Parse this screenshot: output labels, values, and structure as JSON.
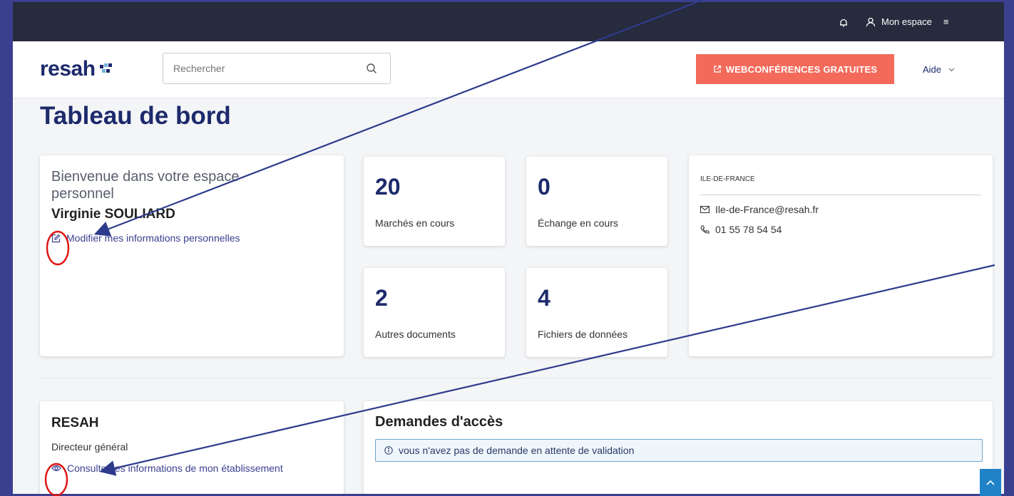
{
  "topbar": {
    "account_label": "Mon espace",
    "menu_glyph": "≡"
  },
  "header": {
    "logo_text": "resah",
    "search_placeholder": "Rechercher",
    "webconf_label": "WEBCONFÉRENCES GRATUITES",
    "help_label": "Aide"
  },
  "page": {
    "title": "Tableau de bord"
  },
  "welcome": {
    "title": "Bienvenue dans votre espace personnel",
    "name": "Virginie SOULIARD",
    "edit_link": "Modifier mes informations personnelles"
  },
  "stats": [
    {
      "value": "20",
      "label": "Marchés en cours"
    },
    {
      "value": "0",
      "label": "Échange en cours"
    },
    {
      "value": "2",
      "label": "Autres documents"
    },
    {
      "value": "4",
      "label": "Fichiers de données"
    }
  ],
  "contact": {
    "region": "ILE-DE-FRANCE",
    "email": "Ile-de-France@resah.fr",
    "phone": "01 55 78 54 54"
  },
  "establishment": {
    "name": "RESAH",
    "role": "Directeur général",
    "view_link": "Consulter les informations de mon établissement"
  },
  "access_requests": {
    "title": "Demandes d'accès",
    "empty_message": "vous n'avez pas de demande en attente de validation"
  },
  "colors": {
    "navy": "#1d2a6b",
    "topbar": "#262b3d",
    "accent_button": "#f36a5a",
    "annotation_arrow": "#2e3b8c",
    "annotation_circle": "#e01616"
  }
}
